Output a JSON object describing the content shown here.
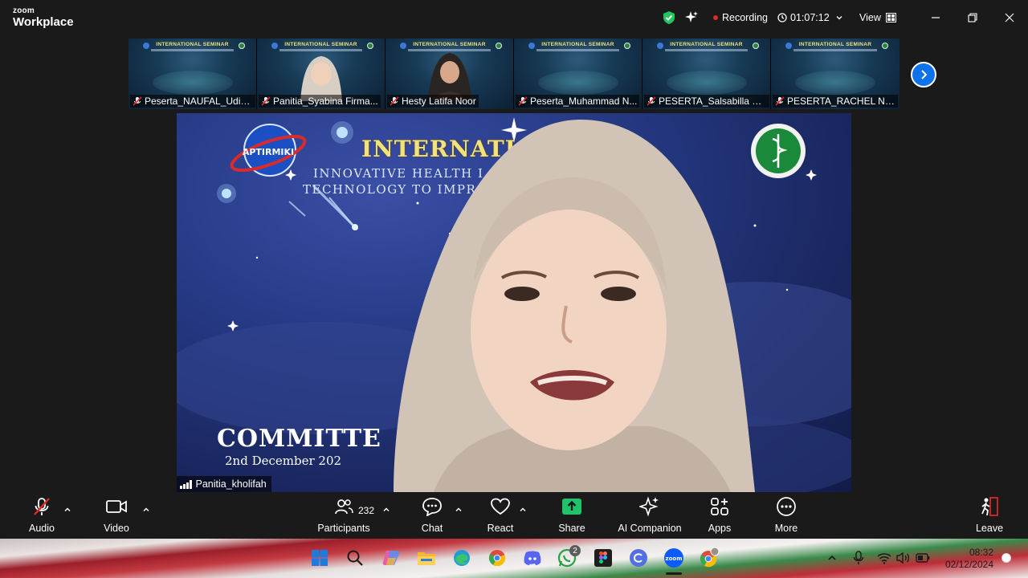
{
  "app": {
    "logo_line1": "zoom",
    "logo_line2": "Workplace"
  },
  "titlebar": {
    "recording_label": "Recording",
    "timer": "01:07:12",
    "view_label": "View"
  },
  "thumbnails": [
    {
      "name": "Peserta_NAUFAL_Udin...",
      "muted": true,
      "video": "slide"
    },
    {
      "name": "Panitia_Syabina Firma...",
      "muted": true,
      "video": "person"
    },
    {
      "name": "Hesty Latifa Noor",
      "muted": true,
      "video": "person-dark"
    },
    {
      "name": "Peserta_Muhammad N...",
      "muted": true,
      "video": "slide"
    },
    {
      "name": "PESERTA_Salsabilla Dy...",
      "muted": true,
      "video": "slide"
    },
    {
      "name": "PESERTA_RACHEL NAY...",
      "muted": true,
      "video": "slide"
    }
  ],
  "thumb_slide_title": "INTERNATIONAL SEMINAR",
  "main_video": {
    "title": "INTERNATIO      MINAR",
    "subtitle1": "INNOVATIVE HEALTH I            : INTEGRATING",
    "subtitle2": "TECHNOLOGY TO IMPR                 ALTH SERVICES",
    "committee": "COMMITTE",
    "date": "2nd December 202",
    "logo_text": "APTIRMIKI",
    "speaker_name": "Panitia_kholifah"
  },
  "toolbar": {
    "audio": "Audio",
    "video": "Video",
    "participants": "Participants",
    "participants_count": "232",
    "chat": "Chat",
    "react": "React",
    "share": "Share",
    "ai_companion": "AI Companion",
    "apps": "Apps",
    "more": "More",
    "leave": "Leave"
  },
  "taskbar": {
    "time": "08:32",
    "date": "02/12/2024",
    "whatsapp_badge": "2"
  },
  "colors": {
    "accent": "#0e72ed",
    "recording": "#e02828",
    "share": "#1ec36a",
    "shield": "#23c55e"
  }
}
